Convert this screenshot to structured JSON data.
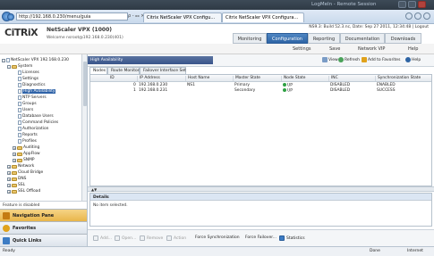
{
  "remote_desktop": {
    "title": "LogMeIn - Remote Session"
  },
  "browser": {
    "address": "http://192.168.0.230/menu/guia",
    "search_hint": "ρ - ⫗ ×",
    "tabs": [
      {
        "label": "Citrix NetScaler VPX Configu..."
      },
      {
        "label": "Citrix NetScaler VPX Configura..."
      }
    ]
  },
  "header": {
    "logo": "CiTRiX",
    "product": "NetScaler VPX (1000)",
    "welcome": "Welcome nsroot@192.168.0.230(401)",
    "build_info": "NS9.3: Build 52.3.nc, Date: Sep 27 2011, 12:34:48 | Logout",
    "tabs": [
      {
        "label": "Monitoring"
      },
      {
        "label": "Configuration"
      },
      {
        "label": "Reporting"
      },
      {
        "label": "Documentation"
      },
      {
        "label": "Downloads"
      }
    ],
    "toolbar": {
      "settings": "Settings",
      "save": "Save",
      "network_vip": "Network VIP",
      "help": "Help"
    }
  },
  "tree": {
    "root": "NetScaler VPX 192.168.0.230",
    "system": "System",
    "items": [
      "Licenses",
      "Settings",
      "Diagnostics",
      "High Availability",
      "NTP Servers",
      "Groups",
      "Users",
      "Database Users",
      "Command Policies",
      "Authorization",
      "Reports",
      "Profiles"
    ],
    "sub_folders": [
      "Auditing",
      "AppFlow",
      "SNMP"
    ],
    "folders": [
      "Network",
      "Cloud Bridge",
      "DNS",
      "SSL",
      "SSL Offload"
    ],
    "feature_status": "Feature is disabled"
  },
  "nav_panels": [
    {
      "label": "Navigation Pane"
    },
    {
      "label": "Favorites"
    },
    {
      "label": "Quick Links"
    }
  ],
  "panel": {
    "title": "High Availability",
    "actions": {
      "view": "View",
      "refresh": "Refresh",
      "add_favorites": "Add to Favorites",
      "help": "Help"
    },
    "subtabs": [
      {
        "label": "Nodes"
      },
      {
        "label": "Route Monitors"
      },
      {
        "label": "Failover Interface Set"
      }
    ],
    "columns": [
      "ID",
      "IP Address",
      "Host Name",
      "Master State",
      "Node State",
      "INC",
      "Synchronization State"
    ],
    "rows": [
      {
        "id": "0",
        "ip": "192.168.0.230",
        "host": "NS1",
        "master": "Primary",
        "node": "UP",
        "inc": "DISABLED",
        "sync": "ENABLED"
      },
      {
        "id": "1",
        "ip": "192.168.0.231",
        "host": "",
        "master": "Secondary",
        "node": "UP",
        "inc": "DISABLED",
        "sync": "SUCCESS"
      }
    ],
    "details": {
      "title": "Details",
      "empty": "No item selected."
    },
    "buttons": {
      "add": "Add...",
      "open": "Open...",
      "remove": "Remove",
      "action": "Action",
      "force_sync": "Force Synchronization",
      "force_failover": "Force Failover...",
      "statistics": "Statistics"
    }
  },
  "statusbar": {
    "ready": "Ready",
    "done": "Done",
    "zone": "Internet"
  },
  "colors": {
    "accent": "#2e64a4",
    "up": "#2ea043"
  }
}
